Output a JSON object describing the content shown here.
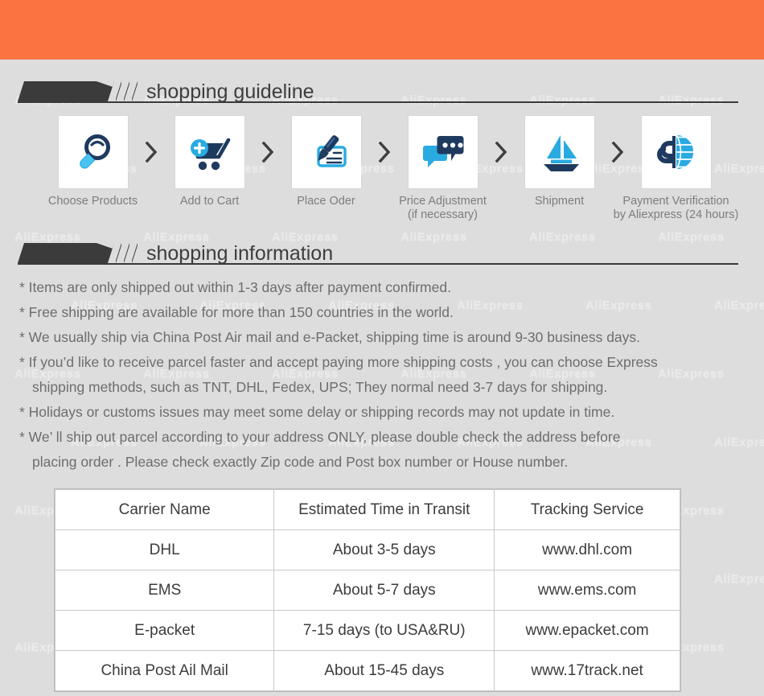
{
  "page": {
    "background_color": "#dddddd",
    "banner_color": "#fb7340",
    "accent_dark": "#1e3a5f",
    "accent_blue": "#29abe2",
    "watermark_text": "AliExpress"
  },
  "sections": {
    "guideline": {
      "title": "shopping guideline"
    },
    "information": {
      "title": "shopping information"
    }
  },
  "steps": [
    {
      "icon": "magnifier-icon",
      "label_line1": "Choose Products",
      "label_line2": ""
    },
    {
      "icon": "add-to-cart-icon",
      "label_line1": "Add to Cart",
      "label_line2": ""
    },
    {
      "icon": "write-check-icon",
      "label_line1": "Place Oder",
      "label_line2": ""
    },
    {
      "icon": "chat-bubbles-icon",
      "label_line1": "Price Adjustment",
      "label_line2": "(if necessary)"
    },
    {
      "icon": "sailboat-icon",
      "label_line1": "Shipment",
      "label_line2": ""
    },
    {
      "icon": "dollar-globe-icon",
      "label_line1": "Payment Verification",
      "label_line2": "by  Aliexpress (24 hours)"
    }
  ],
  "step_separator_icon": "chevron-right-icon",
  "info_lines": [
    {
      "text": "* Items are only shipped out within 1-3 days after payment confirmed.",
      "indent": false
    },
    {
      "text": "* Free shipping are available for more than 150 countries in the world.",
      "indent": false
    },
    {
      "text": "* We usually ship via China Post Air mail and e-Packet, shipping time is around 9-30 business days.",
      "indent": false
    },
    {
      "text": "* If you’d like to receive parcel faster and accept paying more shipping costs , you can choose Express",
      "indent": false
    },
    {
      "text": "shipping methods, such as TNT, DHL, Fedex, UPS; They normal need 3-7 days for shipping.",
      "indent": true
    },
    {
      "text": "* Holidays or customs issues may meet some delay or shipping records may not update in time.",
      "indent": false
    },
    {
      "text": "* We’ ll ship out parcel according to your address ONLY, please double check the address before",
      "indent": false
    },
    {
      "text": "placing order . Please check exactly Zip code and Post box number or House number.",
      "indent": true
    }
  ],
  "carrier_table": {
    "headers": [
      "Carrier Name",
      "Estimated Time in Transit",
      "Tracking Service"
    ],
    "rows": [
      {
        "carrier": "DHL",
        "time": "About 3-5 days",
        "tracking": "www.dhl.com"
      },
      {
        "carrier": "EMS",
        "time": "About 5-7 days",
        "tracking": "www.ems.com"
      },
      {
        "carrier": "E-packet",
        "time": "7-15 days (to USA&RU)",
        "tracking": "www.epacket.com"
      },
      {
        "carrier": "China Post Ail Mail",
        "time": "About 15-45 days",
        "tracking": "www.17track.net"
      }
    ]
  }
}
